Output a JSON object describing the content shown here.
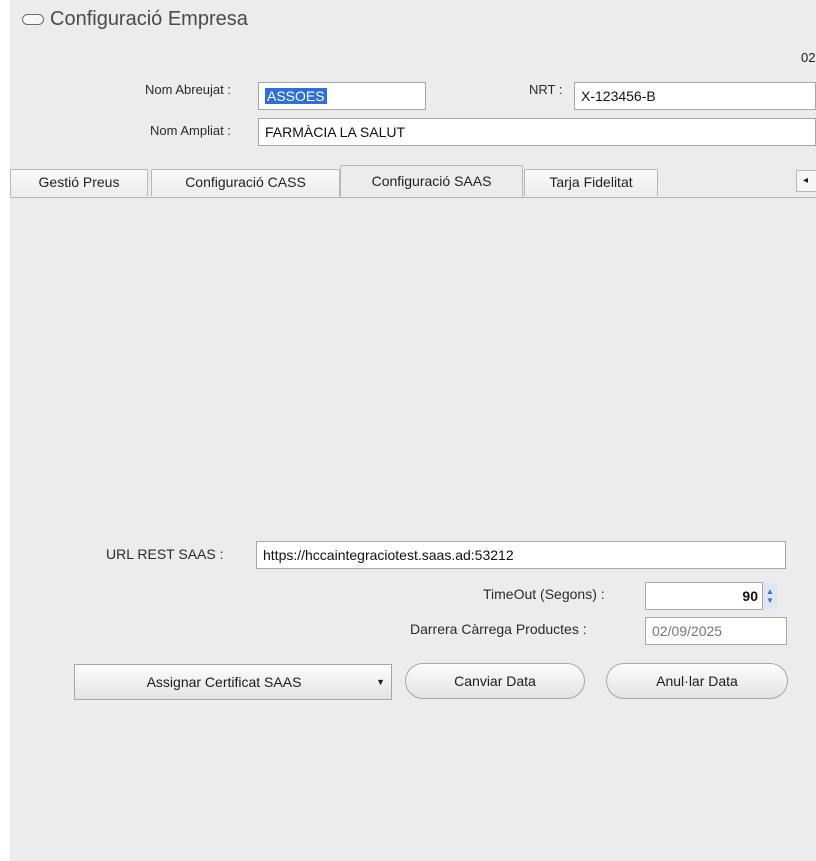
{
  "window": {
    "title": "Configuració Empresa",
    "corner_text": "02"
  },
  "form": {
    "nom_abreujat": {
      "label": "Nom Abreujat :",
      "value": "ASSOES"
    },
    "nrt": {
      "label": "NRT :",
      "value": "X-123456-B"
    },
    "nom_ampliat": {
      "label": "Nom Ampliat :",
      "value": "FARMÀCIA  LA SALUT"
    }
  },
  "tabs": [
    {
      "label": "Gestió Preus",
      "active": false
    },
    {
      "label": "Configuració CASS",
      "active": false
    },
    {
      "label": "Configuració SAAS",
      "active": true
    },
    {
      "label": "Tarja Fidelitat",
      "active": false
    }
  ],
  "tab_scroll_icon": "arrow-left",
  "saas": {
    "url_label": "URL REST SAAS :",
    "url_value": "https://hccaintegraciotest.saas.ad:53212",
    "timeout_label": "TimeOut (Segons) :",
    "timeout_value": "90",
    "last_load_label": "Darrera Càrrega Productes :",
    "last_load_value": "02/09/2025"
  },
  "buttons": {
    "assign_cert": "Assignar Certificat SAAS",
    "change_date": "Canviar Data",
    "cancel_date": "Anul·lar Data"
  },
  "colors": {
    "selection": "#2f6fd8",
    "panel_bg": "#ececec"
  }
}
